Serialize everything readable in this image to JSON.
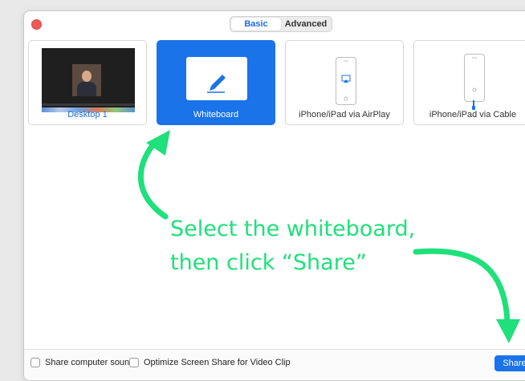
{
  "tabs": [
    {
      "label": "Basic",
      "active": true
    },
    {
      "label": "Advanced",
      "active": false
    }
  ],
  "tiles": [
    {
      "label": "Desktop 1",
      "icon": "desktop-thumbnail"
    },
    {
      "label": "Whiteboard",
      "icon": "pencil-icon",
      "selected": true
    },
    {
      "label": "iPhone/iPad via AirPlay",
      "icon": "airplay-icon"
    },
    {
      "label": "iPhone/iPad via Cable",
      "icon": "cable-icon"
    }
  ],
  "footer": {
    "share_sound": "Share computer sound",
    "optimize": "Optimize Screen Share for Video Clip",
    "share_button": "Share"
  },
  "annotation": {
    "line1": "Select the whiteboard,",
    "line2": "then click “Share”",
    "color": "#1fe07a"
  },
  "colors": {
    "accent": "#1a73e8",
    "close": "#ee5a5a"
  }
}
